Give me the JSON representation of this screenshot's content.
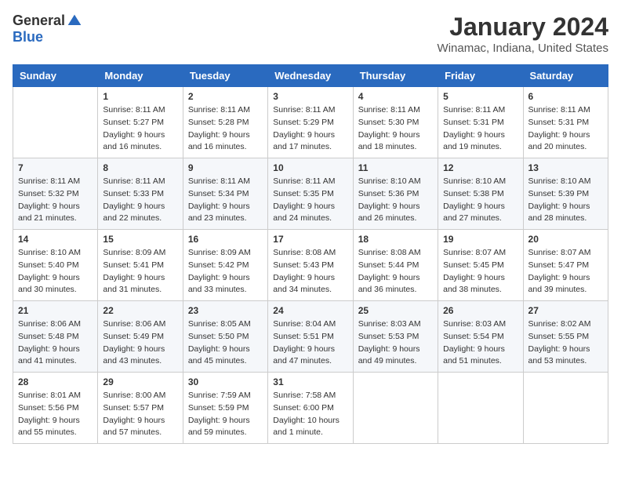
{
  "logo": {
    "general": "General",
    "blue": "Blue"
  },
  "title": "January 2024",
  "location": "Winamac, Indiana, United States",
  "days_header": [
    "Sunday",
    "Monday",
    "Tuesday",
    "Wednesday",
    "Thursday",
    "Friday",
    "Saturday"
  ],
  "weeks": [
    [
      {
        "day": "",
        "sunrise": "",
        "sunset": "",
        "daylight": ""
      },
      {
        "day": "1",
        "sunrise": "Sunrise: 8:11 AM",
        "sunset": "Sunset: 5:27 PM",
        "daylight": "Daylight: 9 hours and 16 minutes."
      },
      {
        "day": "2",
        "sunrise": "Sunrise: 8:11 AM",
        "sunset": "Sunset: 5:28 PM",
        "daylight": "Daylight: 9 hours and 16 minutes."
      },
      {
        "day": "3",
        "sunrise": "Sunrise: 8:11 AM",
        "sunset": "Sunset: 5:29 PM",
        "daylight": "Daylight: 9 hours and 17 minutes."
      },
      {
        "day": "4",
        "sunrise": "Sunrise: 8:11 AM",
        "sunset": "Sunset: 5:30 PM",
        "daylight": "Daylight: 9 hours and 18 minutes."
      },
      {
        "day": "5",
        "sunrise": "Sunrise: 8:11 AM",
        "sunset": "Sunset: 5:31 PM",
        "daylight": "Daylight: 9 hours and 19 minutes."
      },
      {
        "day": "6",
        "sunrise": "Sunrise: 8:11 AM",
        "sunset": "Sunset: 5:31 PM",
        "daylight": "Daylight: 9 hours and 20 minutes."
      }
    ],
    [
      {
        "day": "7",
        "sunrise": "Sunrise: 8:11 AM",
        "sunset": "Sunset: 5:32 PM",
        "daylight": "Daylight: 9 hours and 21 minutes."
      },
      {
        "day": "8",
        "sunrise": "Sunrise: 8:11 AM",
        "sunset": "Sunset: 5:33 PM",
        "daylight": "Daylight: 9 hours and 22 minutes."
      },
      {
        "day": "9",
        "sunrise": "Sunrise: 8:11 AM",
        "sunset": "Sunset: 5:34 PM",
        "daylight": "Daylight: 9 hours and 23 minutes."
      },
      {
        "day": "10",
        "sunrise": "Sunrise: 8:11 AM",
        "sunset": "Sunset: 5:35 PM",
        "daylight": "Daylight: 9 hours and 24 minutes."
      },
      {
        "day": "11",
        "sunrise": "Sunrise: 8:10 AM",
        "sunset": "Sunset: 5:36 PM",
        "daylight": "Daylight: 9 hours and 26 minutes."
      },
      {
        "day": "12",
        "sunrise": "Sunrise: 8:10 AM",
        "sunset": "Sunset: 5:38 PM",
        "daylight": "Daylight: 9 hours and 27 minutes."
      },
      {
        "day": "13",
        "sunrise": "Sunrise: 8:10 AM",
        "sunset": "Sunset: 5:39 PM",
        "daylight": "Daylight: 9 hours and 28 minutes."
      }
    ],
    [
      {
        "day": "14",
        "sunrise": "Sunrise: 8:10 AM",
        "sunset": "Sunset: 5:40 PM",
        "daylight": "Daylight: 9 hours and 30 minutes."
      },
      {
        "day": "15",
        "sunrise": "Sunrise: 8:09 AM",
        "sunset": "Sunset: 5:41 PM",
        "daylight": "Daylight: 9 hours and 31 minutes."
      },
      {
        "day": "16",
        "sunrise": "Sunrise: 8:09 AM",
        "sunset": "Sunset: 5:42 PM",
        "daylight": "Daylight: 9 hours and 33 minutes."
      },
      {
        "day": "17",
        "sunrise": "Sunrise: 8:08 AM",
        "sunset": "Sunset: 5:43 PM",
        "daylight": "Daylight: 9 hours and 34 minutes."
      },
      {
        "day": "18",
        "sunrise": "Sunrise: 8:08 AM",
        "sunset": "Sunset: 5:44 PM",
        "daylight": "Daylight: 9 hours and 36 minutes."
      },
      {
        "day": "19",
        "sunrise": "Sunrise: 8:07 AM",
        "sunset": "Sunset: 5:45 PM",
        "daylight": "Daylight: 9 hours and 38 minutes."
      },
      {
        "day": "20",
        "sunrise": "Sunrise: 8:07 AM",
        "sunset": "Sunset: 5:47 PM",
        "daylight": "Daylight: 9 hours and 39 minutes."
      }
    ],
    [
      {
        "day": "21",
        "sunrise": "Sunrise: 8:06 AM",
        "sunset": "Sunset: 5:48 PM",
        "daylight": "Daylight: 9 hours and 41 minutes."
      },
      {
        "day": "22",
        "sunrise": "Sunrise: 8:06 AM",
        "sunset": "Sunset: 5:49 PM",
        "daylight": "Daylight: 9 hours and 43 minutes."
      },
      {
        "day": "23",
        "sunrise": "Sunrise: 8:05 AM",
        "sunset": "Sunset: 5:50 PM",
        "daylight": "Daylight: 9 hours and 45 minutes."
      },
      {
        "day": "24",
        "sunrise": "Sunrise: 8:04 AM",
        "sunset": "Sunset: 5:51 PM",
        "daylight": "Daylight: 9 hours and 47 minutes."
      },
      {
        "day": "25",
        "sunrise": "Sunrise: 8:03 AM",
        "sunset": "Sunset: 5:53 PM",
        "daylight": "Daylight: 9 hours and 49 minutes."
      },
      {
        "day": "26",
        "sunrise": "Sunrise: 8:03 AM",
        "sunset": "Sunset: 5:54 PM",
        "daylight": "Daylight: 9 hours and 51 minutes."
      },
      {
        "day": "27",
        "sunrise": "Sunrise: 8:02 AM",
        "sunset": "Sunset: 5:55 PM",
        "daylight": "Daylight: 9 hours and 53 minutes."
      }
    ],
    [
      {
        "day": "28",
        "sunrise": "Sunrise: 8:01 AM",
        "sunset": "Sunset: 5:56 PM",
        "daylight": "Daylight: 9 hours and 55 minutes."
      },
      {
        "day": "29",
        "sunrise": "Sunrise: 8:00 AM",
        "sunset": "Sunset: 5:57 PM",
        "daylight": "Daylight: 9 hours and 57 minutes."
      },
      {
        "day": "30",
        "sunrise": "Sunrise: 7:59 AM",
        "sunset": "Sunset: 5:59 PM",
        "daylight": "Daylight: 9 hours and 59 minutes."
      },
      {
        "day": "31",
        "sunrise": "Sunrise: 7:58 AM",
        "sunset": "Sunset: 6:00 PM",
        "daylight": "Daylight: 10 hours and 1 minute."
      },
      {
        "day": "",
        "sunrise": "",
        "sunset": "",
        "daylight": ""
      },
      {
        "day": "",
        "sunrise": "",
        "sunset": "",
        "daylight": ""
      },
      {
        "day": "",
        "sunrise": "",
        "sunset": "",
        "daylight": ""
      }
    ]
  ]
}
